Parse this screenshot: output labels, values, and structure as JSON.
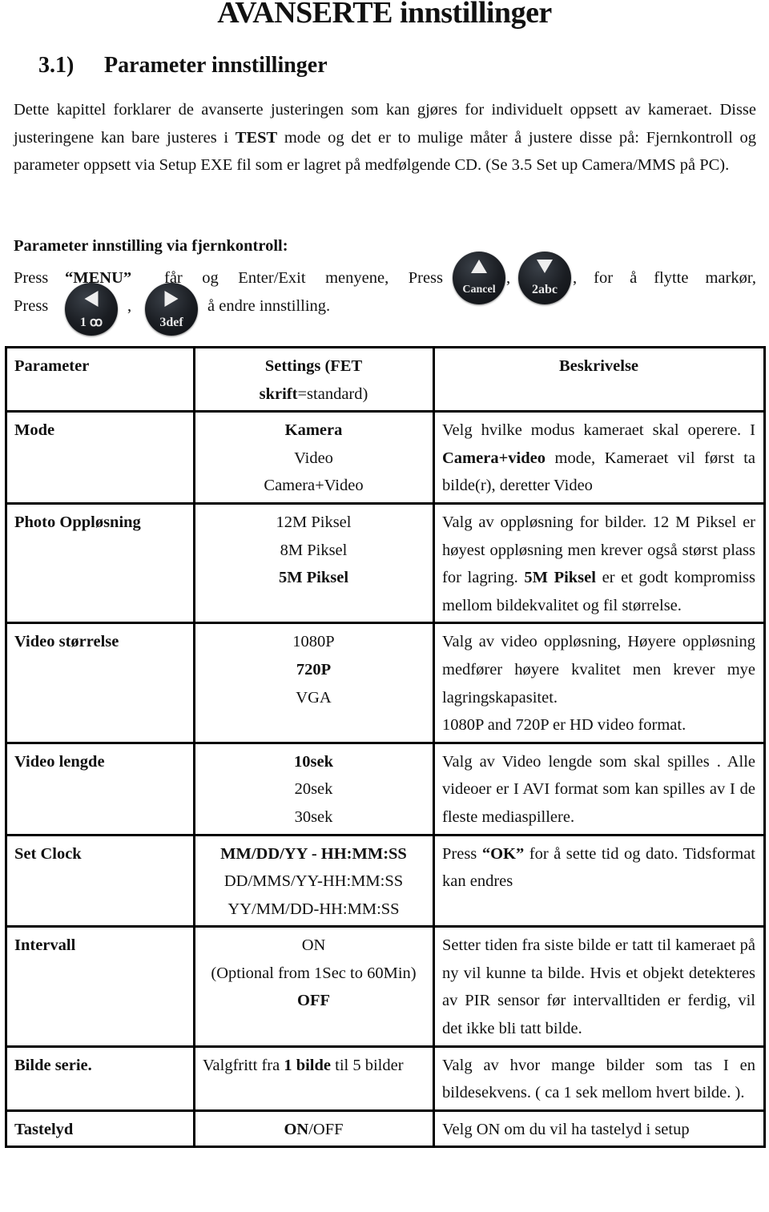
{
  "title": "AVANSERTE innstillinger",
  "section": {
    "number": "3.1)",
    "title": "Parameter innstillinger"
  },
  "intro": {
    "part1": "Dette kapittel forklarer de avanserte justeringen som kan gjøres for individuelt oppsett av kameraet. Disse justeringene kan bare justeres i ",
    "bold": "TEST",
    "part2": " mode og det er to mulige måter å justere disse på: Fjernkontroll og parameter oppsett via Setup EXE fil som er lagret på medfølgende CD. (Se 3.5 Set up Camera/MMS på PC)."
  },
  "remote": {
    "heading": "Parameter innstilling via fjernkontroll:",
    "press": "Press",
    "menu_quote": "“MENU”",
    "menu_text": "får og Enter/Exit menyene, Press",
    "comma": ",",
    "move_text": ", for å flytte markør,",
    "press2": "Press",
    "change_text": "å endre innstilling.",
    "buttons": [
      {
        "name": "up",
        "label": "Cancel",
        "icon": "triangle-up"
      },
      {
        "name": "down",
        "label": "2abc",
        "icon": "triangle-down"
      },
      {
        "name": "left",
        "label": "1 ꝏ",
        "icon": "triangle-left"
      },
      {
        "name": "right",
        "label": "3def",
        "icon": "triangle-right"
      }
    ]
  },
  "table": {
    "headers": {
      "parameter": "Parameter",
      "settings_bold": "Settings (FET",
      "settings_bold2": "skrift",
      "settings_rest": "=standard)",
      "description": "Beskrivelse"
    },
    "rows": [
      {
        "parameter": "Mode",
        "settings": [
          {
            "text": "Kamera",
            "bold": true
          },
          {
            "text": "Video",
            "bold": false
          },
          {
            "text": "Camera+Video",
            "bold": false
          }
        ],
        "description": {
          "a": "Velg hvilke modus kameraet skal operere. I ",
          "b": "Camera+video",
          "c": " mode, Kameraet vil først ta bilde(r), deretter Video"
        }
      },
      {
        "parameter": "Photo Oppløsning",
        "settings": [
          {
            "text": "12M Piksel",
            "bold": false
          },
          {
            "text": "8M Piksel",
            "bold": false
          },
          {
            "text": "5M Piksel",
            "bold": true
          }
        ],
        "description": {
          "a": "Valg av oppløsning for bilder. 12 M Piksel er høyest oppløsning men krever også størst plass for lagring. ",
          "b": "5M Piksel",
          "c": " er et godt kompromiss mellom bildekvalitet og fil størrelse."
        }
      },
      {
        "parameter": "Video størrelse",
        "settings": [
          {
            "text": "1080P",
            "bold": false
          },
          {
            "text": "720P",
            "bold": true
          },
          {
            "text": "VGA",
            "bold": false
          }
        ],
        "description": {
          "a": "Valg av video oppløsning, Høyere oppløsning medfører høyere kvalitet men krever mye lagringskapasitet.",
          "b": "",
          "c": "",
          "extra": "1080P and 720P er HD video format."
        }
      },
      {
        "parameter": "Video lengde",
        "settings": [
          {
            "text": "10sek",
            "bold": true
          },
          {
            "text": "20sek",
            "bold": false
          },
          {
            "text": "30sek",
            "bold": false
          }
        ],
        "description": {
          "a": "Valg av Video lengde som skal spilles . Alle videoer er I AVI format som kan spilles av I de fleste mediaspillere.",
          "b": "",
          "c": ""
        }
      },
      {
        "parameter": "Set Clock",
        "settings": [
          {
            "text": "MM/DD/YY - HH:MM:SS",
            "bold": true
          },
          {
            "text": "DD/MMS/YY-HH:MM:SS",
            "bold": false
          },
          {
            "text": "YY/MM/DD-HH:MM:SS",
            "bold": false
          }
        ],
        "description": {
          "a": "Press ",
          "b": "“OK”",
          "c": " for å sette tid og dato. Tidsformat kan endres"
        }
      },
      {
        "parameter": "Intervall",
        "settings": [
          {
            "text": "ON",
            "bold": false
          },
          {
            "text": "(Optional from 1Sec to 60Min)",
            "bold": false
          },
          {
            "text": "OFF",
            "bold": true
          }
        ],
        "description": {
          "a": "Setter tiden fra siste bilde er tatt til kameraet på ny vil kunne ta bilde. Hvis et objekt detekteres av PIR sensor før intervalltiden er ferdig, vil det ikke bli tatt bilde.",
          "b": "",
          "c": ""
        }
      },
      {
        "parameter": "Bilde serie.",
        "settings_inline": {
          "a": "Valgfritt fra ",
          "b": "1 bilde",
          "c": " til 5 bilder"
        },
        "description": {
          "a": "Valg av hvor mange bilder som tas I en bildesekvens. ( ca 1 sek mellom hvert bilde. ).",
          "b": "",
          "c": ""
        }
      },
      {
        "parameter": "Tastelyd",
        "settings_inline": {
          "a": "",
          "b": "ON",
          "c": "/OFF"
        },
        "description": {
          "a": "Velg ON om du vil ha tastelyd i setup",
          "b": "",
          "c": ""
        }
      }
    ]
  }
}
